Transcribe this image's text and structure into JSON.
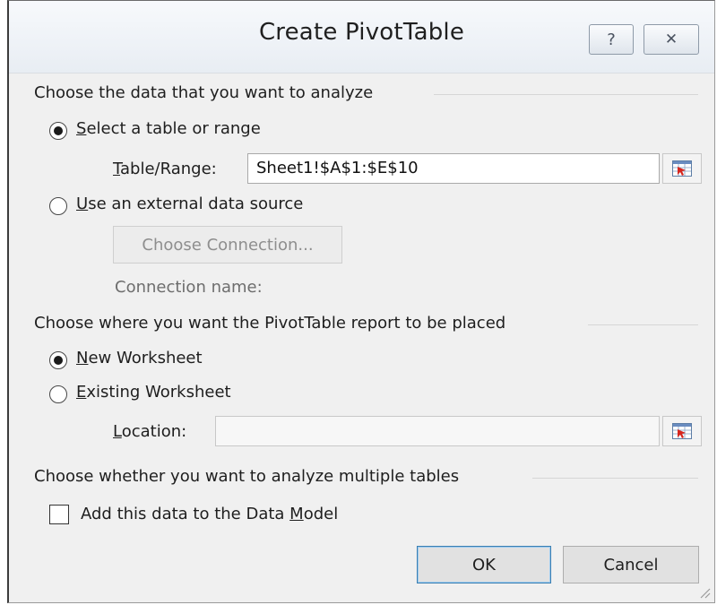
{
  "dialog": {
    "title": "Create PivotTable",
    "help_glyph": "?",
    "close_glyph": "✕"
  },
  "analyze": {
    "heading": "Choose the data that you want to analyze",
    "select_table": {
      "mnemonic": "S",
      "rest": "elect a table or range",
      "selected": true
    },
    "table_range": {
      "mnemonic": "T",
      "rest": "able/Range:",
      "value": "Sheet1!$A$1:$E$10"
    },
    "external": {
      "mnemonic": "U",
      "rest": "se an external data source",
      "selected": false
    },
    "choose_connection_label": "Choose Connection...",
    "connection_name_label": "Connection name:"
  },
  "placement": {
    "heading": "Choose where you want the PivotTable report to be placed",
    "new_worksheet": {
      "mnemonic": "N",
      "rest": "ew Worksheet",
      "selected": true
    },
    "existing_worksheet": {
      "mnemonic": "E",
      "rest": "xisting Worksheet",
      "selected": false
    },
    "location": {
      "mnemonic": "L",
      "rest": "ocation:",
      "value": ""
    }
  },
  "multiple": {
    "heading": "Choose whether you want to analyze multiple tables",
    "data_model": {
      "before": "Add this data to the Data ",
      "mnemonic": "M",
      "after": "odel",
      "checked": false
    }
  },
  "buttons": {
    "ok": "OK",
    "cancel": "Cancel"
  },
  "icons": {
    "help": "question-mark-icon",
    "close": "close-icon",
    "range_picker": "collapse-dialog-icon",
    "resize": "resize-grip-icon"
  }
}
